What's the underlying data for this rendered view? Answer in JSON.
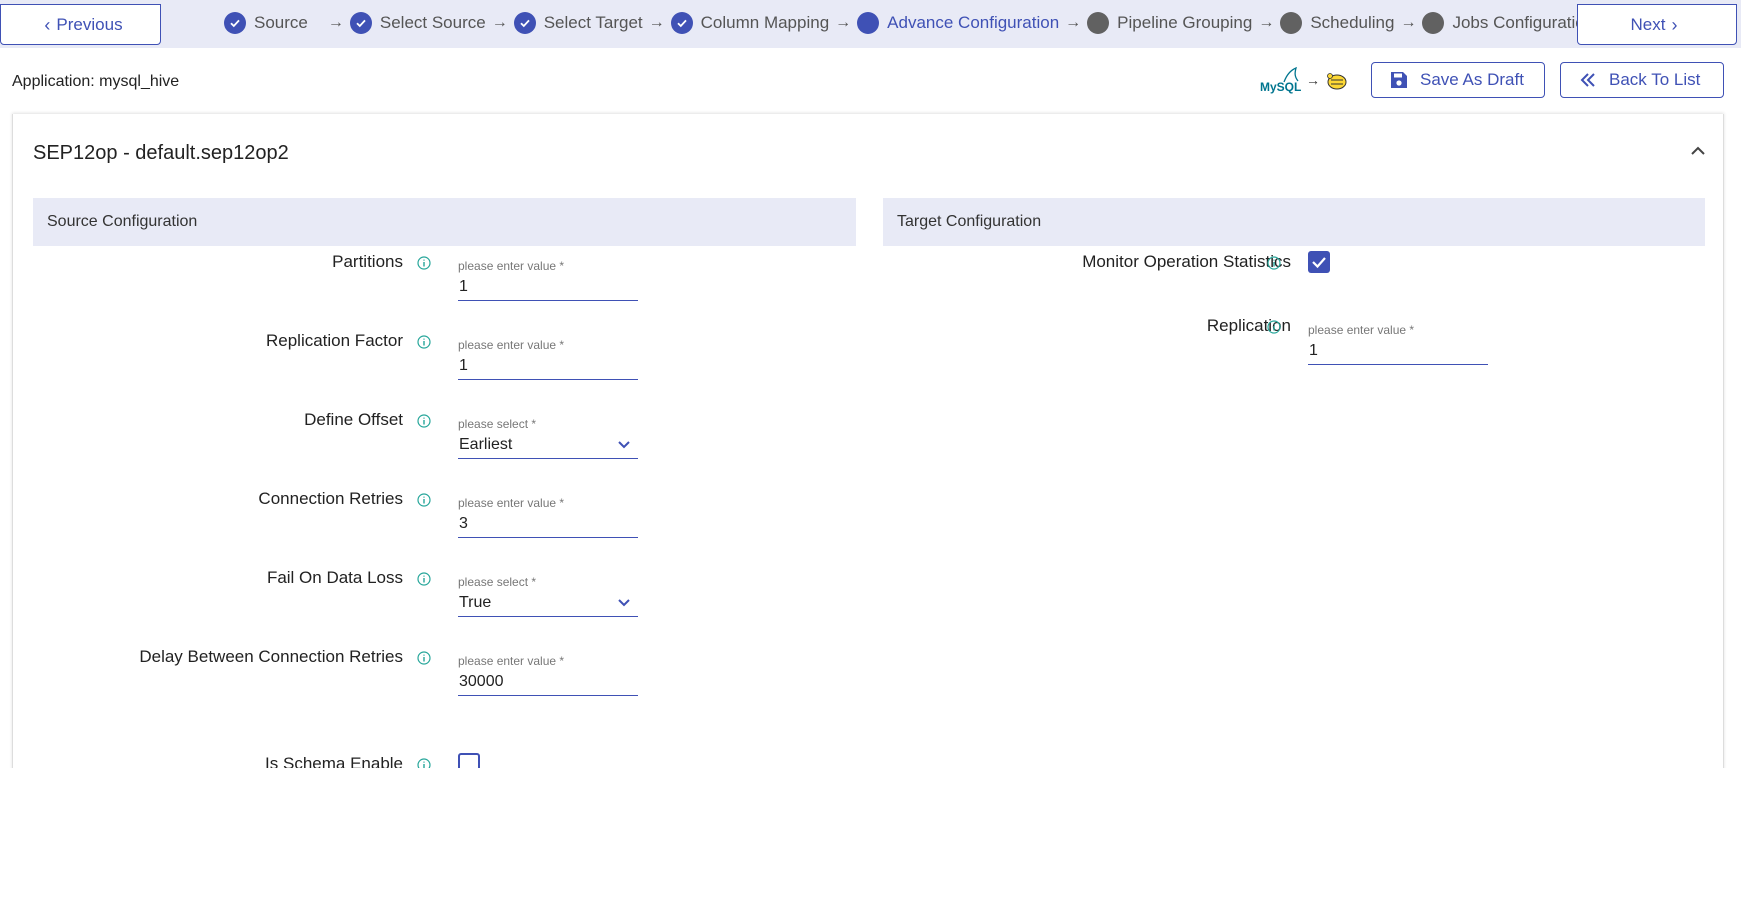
{
  "nav": {
    "previous_label": "Previous",
    "next_label": "Next"
  },
  "steps": [
    {
      "label": "Source",
      "state": "done"
    },
    {
      "label": "Select Source",
      "state": "done"
    },
    {
      "label": "Select Target",
      "state": "done"
    },
    {
      "label": "Column Mapping",
      "state": "done"
    },
    {
      "label": "Advance Configuration",
      "state": "active"
    },
    {
      "label": "Pipeline Grouping",
      "state": "pending"
    },
    {
      "label": "Scheduling",
      "state": "pending"
    },
    {
      "label": "Jobs Configuration",
      "state": "pending"
    }
  ],
  "step_arrow": "→",
  "application": {
    "label": "Application: mysql_hive",
    "source_logo_text": "MySQL",
    "logo_arrow": "→"
  },
  "actions": {
    "save_draft": "Save As Draft",
    "back_to_list": "Back To List"
  },
  "card": {
    "title": "SEP12op - default.sep12op2"
  },
  "source": {
    "heading": "Source Configuration",
    "fields": [
      {
        "label": "Partitions",
        "placeholder": "please enter value *",
        "value": "1",
        "kind": "input"
      },
      {
        "label": "Replication Factor",
        "placeholder": "please enter value *",
        "value": "1",
        "kind": "input"
      },
      {
        "label": "Define Offset",
        "placeholder": "please select *",
        "value": "Earliest",
        "kind": "select"
      },
      {
        "label": "Connection Retries",
        "placeholder": "please enter value *",
        "value": "3",
        "kind": "input"
      },
      {
        "label": "Fail On Data Loss",
        "placeholder": "please select *",
        "value": "True",
        "kind": "select"
      },
      {
        "label": "Delay Between Connection Retries",
        "placeholder": "please enter value *",
        "value": "30000",
        "kind": "input"
      },
      {
        "label": "Is Schema Enable",
        "kind": "checkbox",
        "checked": false
      }
    ]
  },
  "target": {
    "heading": "Target Configuration",
    "monitor": {
      "label": "Monitor Operation Statistics",
      "checked": true
    },
    "replication": {
      "label": "Replication",
      "placeholder": "please enter value *",
      "value": "1"
    }
  },
  "colors": {
    "primary": "#3f51b5",
    "header_bg": "#e8eaf6",
    "pending_step": "#616161"
  }
}
